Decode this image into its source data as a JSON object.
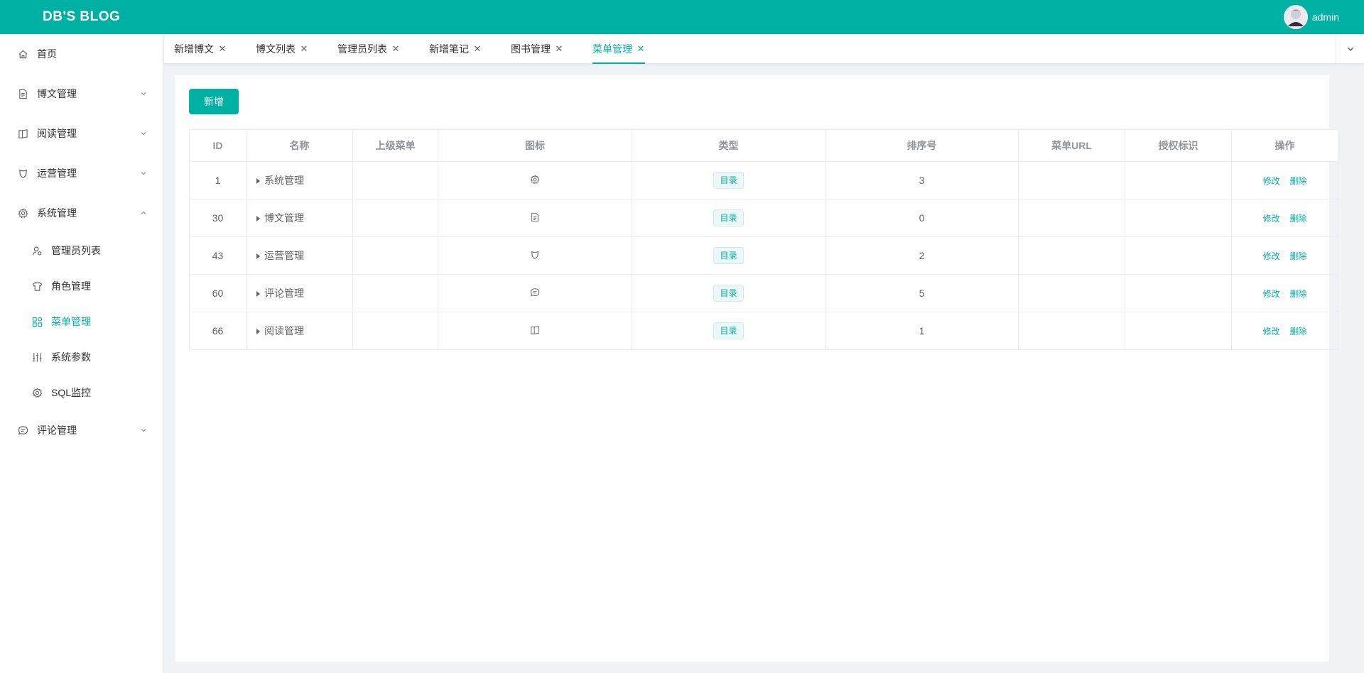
{
  "app": {
    "brand": "DB'S BLOG",
    "accent": "#00b0a2"
  },
  "user": {
    "name": "admin"
  },
  "sidebar": {
    "items": [
      {
        "label": "首页",
        "icon": "home-icon"
      },
      {
        "label": "博文管理",
        "icon": "document-icon",
        "expanded": false
      },
      {
        "label": "阅读管理",
        "icon": "book-icon",
        "expanded": false
      },
      {
        "label": "运营管理",
        "icon": "shield-icon",
        "expanded": false
      },
      {
        "label": "系统管理",
        "icon": "gear-icon",
        "expanded": true
      },
      {
        "label": "评论管理",
        "icon": "chat-icon",
        "expanded": false
      }
    ],
    "sub_items": [
      {
        "label": "管理员列表",
        "icon": "user-settings-icon"
      },
      {
        "label": "角色管理",
        "icon": "shirt-icon"
      },
      {
        "label": "菜单管理",
        "icon": "menu-grid-icon",
        "active": true
      },
      {
        "label": "系统参数",
        "icon": "sliders-icon"
      },
      {
        "label": "SQL监控",
        "icon": "gear-icon"
      }
    ]
  },
  "tabs": [
    {
      "label": "新增博文"
    },
    {
      "label": "博文列表"
    },
    {
      "label": "管理员列表"
    },
    {
      "label": "新增笔记"
    },
    {
      "label": "图书管理"
    },
    {
      "label": "菜单管理",
      "active": true
    }
  ],
  "toolbar": {
    "add_label": "新增"
  },
  "table": {
    "columns": [
      "ID",
      "名称",
      "上级菜单",
      "图标",
      "类型",
      "排序号",
      "菜单URL",
      "授权标识",
      "操作"
    ],
    "rows": [
      {
        "id": "1",
        "name": "系统管理",
        "parent": "",
        "icon": "gear-icon",
        "type": "目录",
        "order": "3",
        "url": "",
        "perm": ""
      },
      {
        "id": "30",
        "name": "博文管理",
        "parent": "",
        "icon": "document-icon",
        "type": "目录",
        "order": "0",
        "url": "",
        "perm": ""
      },
      {
        "id": "43",
        "name": "运营管理",
        "parent": "",
        "icon": "shield-icon",
        "type": "目录",
        "order": "2",
        "url": "",
        "perm": ""
      },
      {
        "id": "60",
        "name": "评论管理",
        "parent": "",
        "icon": "chat-icon",
        "type": "目录",
        "order": "5",
        "url": "",
        "perm": ""
      },
      {
        "id": "66",
        "name": "阅读管理",
        "parent": "",
        "icon": "book-icon",
        "type": "目录",
        "order": "1",
        "url": "",
        "perm": ""
      }
    ],
    "edit_label": "修改",
    "delete_label": "删除"
  }
}
